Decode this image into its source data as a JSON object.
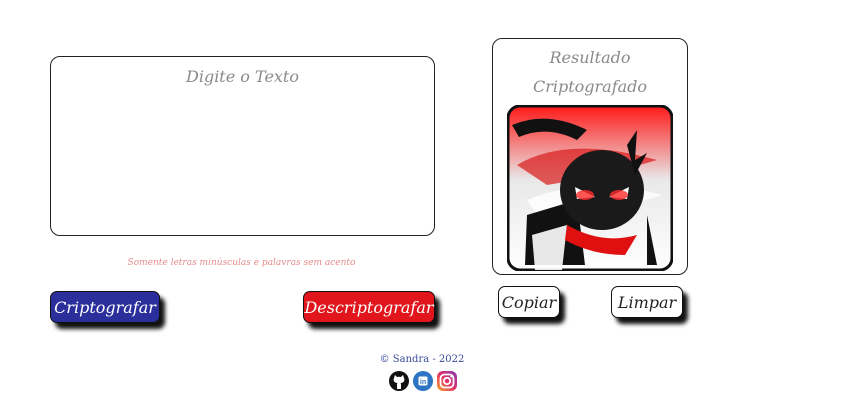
{
  "input": {
    "placeholder": "Digite o Texto",
    "hint": "Somente letras minúsculas e palavras sem acento"
  },
  "buttons": {
    "encrypt": "Criptografar",
    "decrypt": "Descriptografar",
    "copy": "Copiar",
    "clear": "Limpar"
  },
  "result": {
    "title_line1": "Resultado",
    "title_line2": "Criptografado"
  },
  "footer": {
    "credit": "© Sandra - 2022",
    "social_icons": [
      "github-icon",
      "linkedin-icon",
      "instagram-icon"
    ]
  },
  "colors": {
    "encrypt_button": "#2b2f9c",
    "decrypt_button": "#e0161c",
    "hint_text": "#e58b8b"
  }
}
